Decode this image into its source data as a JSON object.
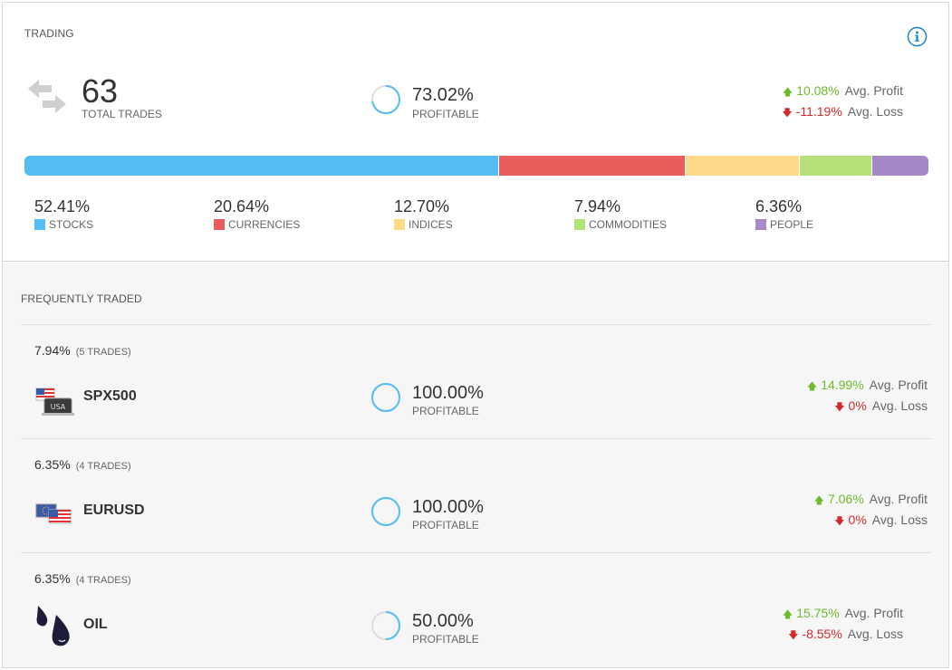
{
  "trading": {
    "section_label": "TRADING",
    "total_trades": "63",
    "total_trades_label": "TOTAL TRADES",
    "profitable_pct": "73.02%",
    "profitable_label": "PROFITABLE",
    "profitable_value": 0.7302,
    "avg_profit": "10.08%",
    "avg_profit_label": "Avg. Profit",
    "avg_loss": "-11.19%",
    "avg_loss_label": "Avg. Loss",
    "breakdown": [
      {
        "pct": "52.41%",
        "label": "STOCKS",
        "value": 52.41,
        "color": "#55bdf5"
      },
      {
        "pct": "20.64%",
        "label": "CURRENCIES",
        "value": 20.64,
        "color": "#e95d5d"
      },
      {
        "pct": "12.70%",
        "label": "INDICES",
        "value": 12.7,
        "color": "#fdd98a"
      },
      {
        "pct": "7.94%",
        "label": "COMMODITIES",
        "value": 7.94,
        "color": "#b6e07a"
      },
      {
        "pct": "6.36%",
        "label": "PEOPLE",
        "value": 6.36,
        "color": "#a688c6"
      }
    ]
  },
  "frequent": {
    "section_label": "FREQUENTLY TRADED",
    "items": [
      {
        "pct": "7.94%",
        "trades": "(5 TRADES)",
        "name": "SPX500",
        "icon": "usa-flag-icon",
        "profitable_pct": "100.00%",
        "profitable_label": "PROFITABLE",
        "profitable_value": 1.0,
        "avg_profit": "14.99%",
        "avg_profit_label": "Avg. Profit",
        "avg_loss": "0%",
        "avg_loss_label": "Avg. Loss"
      },
      {
        "pct": "6.35%",
        "trades": "(4 TRADES)",
        "name": "EURUSD",
        "icon": "eur-usd-flags-icon",
        "profitable_pct": "100.00%",
        "profitable_label": "PROFITABLE",
        "profitable_value": 1.0,
        "avg_profit": "7.06%",
        "avg_profit_label": "Avg. Profit",
        "avg_loss": "0%",
        "avg_loss_label": "Avg. Loss"
      },
      {
        "pct": "6.35%",
        "trades": "(4 TRADES)",
        "name": "OIL",
        "icon": "oil-drops-icon",
        "profitable_pct": "50.00%",
        "profitable_label": "PROFITABLE",
        "profitable_value": 0.5,
        "avg_profit": "15.75%",
        "avg_profit_label": "Avg. Profit",
        "avg_loss": "-8.55%",
        "avg_loss_label": "Avg. Loss"
      }
    ]
  },
  "colors": {
    "accent": "#55bdf5",
    "profit": "#6dba2c",
    "loss": "#d22a2a",
    "ring_track": "#dddddd"
  }
}
